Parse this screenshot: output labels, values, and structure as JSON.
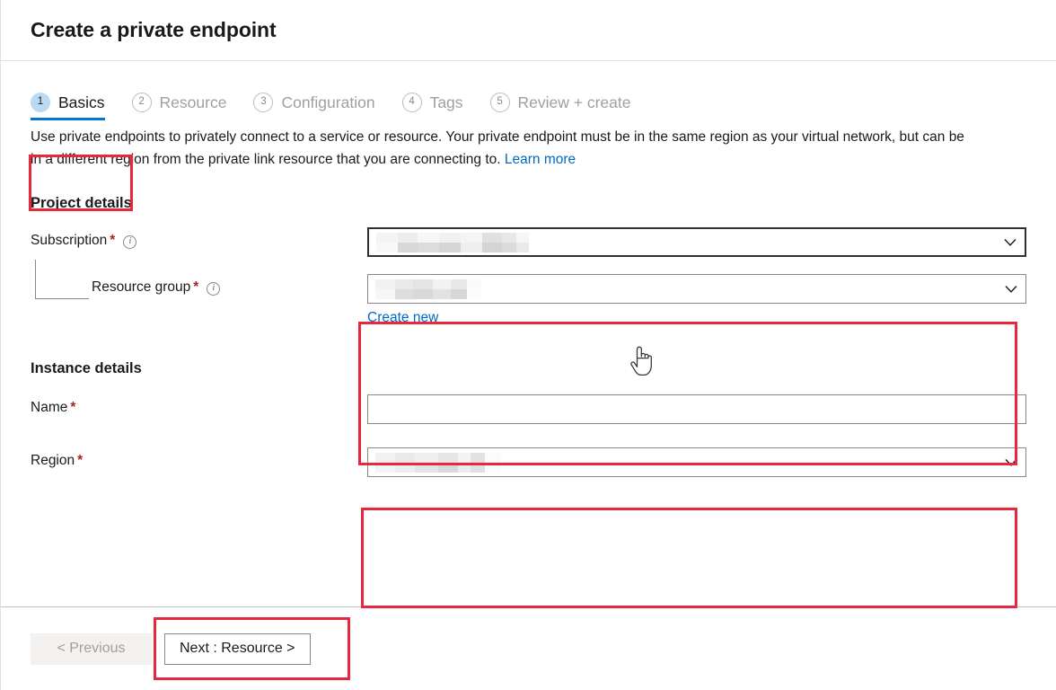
{
  "blade": {
    "title": "Create a private endpoint"
  },
  "wizard": {
    "tabs": [
      {
        "num": "1",
        "label": "Basics",
        "state": "active"
      },
      {
        "num": "2",
        "label": "Resource",
        "state": "inactive"
      },
      {
        "num": "3",
        "label": "Configuration",
        "state": "inactive"
      },
      {
        "num": "4",
        "label": "Tags",
        "state": "inactive"
      },
      {
        "num": "5",
        "label": "Review + create",
        "state": "inactive"
      }
    ]
  },
  "description": {
    "text": "Use private endpoints to privately connect to a service or resource. Your private endpoint must be in the same region as your virtual network, but can be in a different region from the private link resource that you are connecting to.",
    "link_label": "Learn more"
  },
  "project_details": {
    "heading": "Project details",
    "subscription": {
      "label": "Subscription",
      "required_mark": "*",
      "info_glyph": "i",
      "value": "",
      "redacted": true
    },
    "resource_group": {
      "label": "Resource group",
      "required_mark": "*",
      "info_glyph": "i",
      "value": "",
      "redacted": true,
      "create_new_label": "Create new"
    }
  },
  "instance_details": {
    "heading": "Instance details",
    "name": {
      "label": "Name",
      "required_mark": "*",
      "value": "",
      "placeholder": ""
    },
    "region": {
      "label": "Region",
      "required_mark": "*",
      "value": "",
      "redacted": true
    }
  },
  "footer": {
    "previous_label": "< Previous",
    "next_label": "Next : Resource >"
  },
  "colors": {
    "annotation_red": "#e8283c",
    "accent_blue": "#0078d4",
    "link_blue": "#0069c5",
    "required_red": "#a4262c",
    "active_tab_circle": "#bcd9f2"
  },
  "cursor": {
    "icon": "pointing-hand-cursor"
  }
}
